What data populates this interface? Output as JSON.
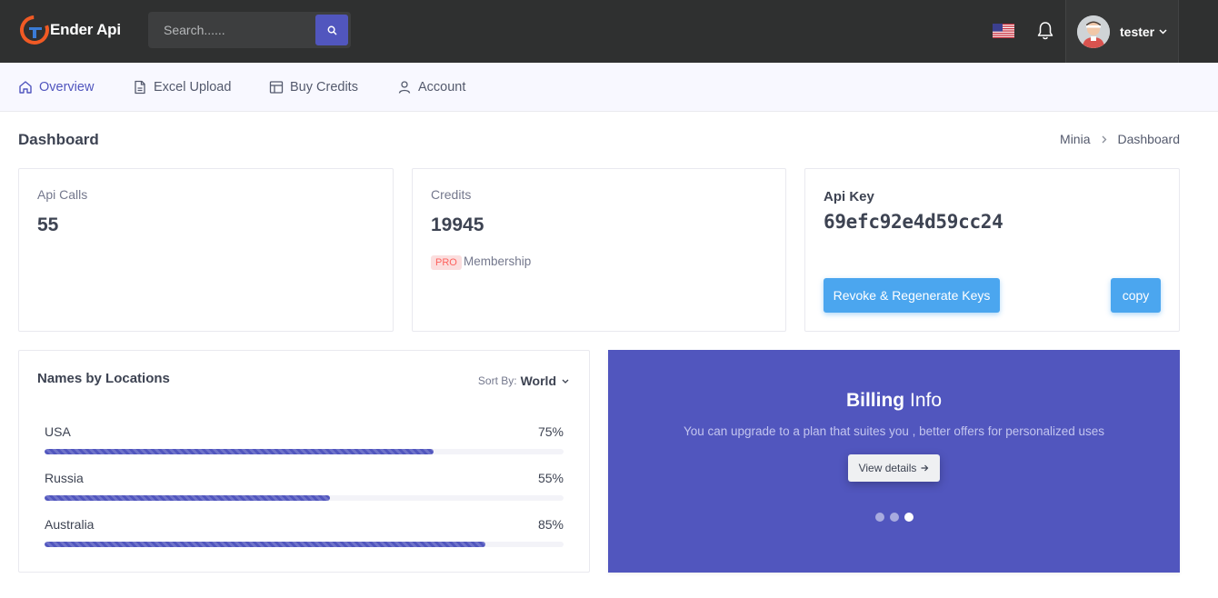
{
  "header": {
    "brand_name": "Ender Api",
    "search_placeholder": "Search......",
    "user_name": "tester"
  },
  "nav": {
    "items": [
      {
        "label": "Overview",
        "icon": "home-icon",
        "active": true
      },
      {
        "label": "Excel Upload",
        "icon": "file-icon",
        "active": false
      },
      {
        "label": "Buy Credits",
        "icon": "layout-icon",
        "active": false
      },
      {
        "label": "Account",
        "icon": "user-icon",
        "active": false
      }
    ]
  },
  "page": {
    "title": "Dashboard",
    "breadcrumb": [
      "Minia",
      "Dashboard"
    ]
  },
  "stats": {
    "api_calls": {
      "label": "Api Calls",
      "value": "55"
    },
    "credits": {
      "label": "Credits",
      "value": "19945",
      "badge": "PRO",
      "badge_text": "Membership"
    },
    "api_key": {
      "title": "Api Key",
      "value": "69efc92e4d59cc24",
      "revoke_label": "Revoke & Regenerate Keys",
      "copy_label": "copy"
    }
  },
  "locations": {
    "title": "Names by Locations",
    "sort_label": "Sort By:",
    "sort_value": "World",
    "rows": [
      {
        "name": "USA",
        "percent_label": "75%",
        "percent": 75
      },
      {
        "name": "Russia",
        "percent_label": "55%",
        "percent": 55
      },
      {
        "name": "Australia",
        "percent_label": "85%",
        "percent": 85
      }
    ]
  },
  "billing": {
    "title_bold": "Billing",
    "title_rest": "Info",
    "description": "You can upgrade to a plan that suites you , better offers for personalized uses",
    "button_label": "View details",
    "slides": 3,
    "active_slide": 3
  },
  "colors": {
    "primary": "#5156be",
    "topbar": "#2f3030",
    "button_blue": "#4ba6ef",
    "badge_bg": "#fbdede",
    "badge_text": "#fd625e"
  }
}
